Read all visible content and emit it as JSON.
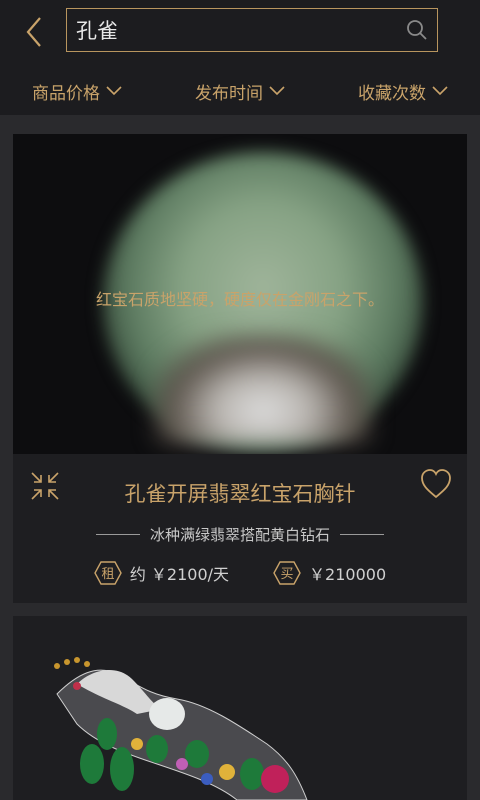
{
  "search": {
    "query": "孔雀"
  },
  "filters": [
    {
      "label": "商品价格"
    },
    {
      "label": "发布时间"
    },
    {
      "label": "收藏次数"
    }
  ],
  "products": [
    {
      "overlay_text": "红宝石质地坚硬，硬度仅在金刚石之下。",
      "title": "孔雀开屏翡翠红宝石胸针",
      "subtitle": "冰种满绿翡翠搭配黄白钻石",
      "rent_badge": "租",
      "rent_price": "约 ￥2100/天",
      "buy_badge": "买",
      "buy_price": "￥210000"
    }
  ],
  "colors": {
    "accent": "#c9a36a",
    "background": "#2a2a2d",
    "header": "#1c1c1f",
    "card": "#1e1e21"
  },
  "icons": [
    "back-arrow-icon",
    "search-icon",
    "chevron-down-icon",
    "collapse-icon",
    "heart-icon",
    "rent-badge-icon",
    "buy-badge-icon"
  ]
}
